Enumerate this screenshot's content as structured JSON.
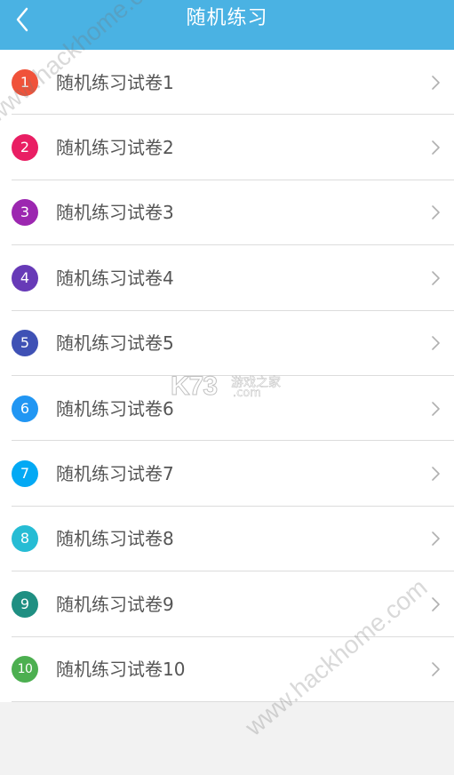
{
  "header": {
    "title": "随机练习",
    "background_color": "#4ab2e3",
    "back_icon": "chevron-left-icon"
  },
  "list": {
    "chevron_icon": "chevron-right-icon",
    "items": [
      {
        "number": "1",
        "label": "随机练习试卷1",
        "color": "#f0523a"
      },
      {
        "number": "2",
        "label": "随机练习试卷2",
        "color": "#e91e63"
      },
      {
        "number": "3",
        "label": "随机练习试卷3",
        "color": "#9c27b0"
      },
      {
        "number": "4",
        "label": "随机练习试卷4",
        "color": "#673ab7"
      },
      {
        "number": "5",
        "label": "随机练习试卷5",
        "color": "#3f51b5"
      },
      {
        "number": "6",
        "label": "随机练习试卷6",
        "color": "#2196f3"
      },
      {
        "number": "7",
        "label": "随机练习试卷7",
        "color": "#03a9f4"
      },
      {
        "number": "8",
        "label": "随机练习试卷8",
        "color": "#26bcd4"
      },
      {
        "number": "9",
        "label": "随机练习试卷9",
        "color": "#1f8f82"
      },
      {
        "number": "10",
        "label": "随机练习试卷10",
        "color": "#4caf50"
      }
    ]
  },
  "watermark": {
    "site_text": "www.hackhome.com",
    "logo_main": "K73",
    "logo_sub_1": "游戏之家",
    "logo_sub_2": ".com"
  }
}
